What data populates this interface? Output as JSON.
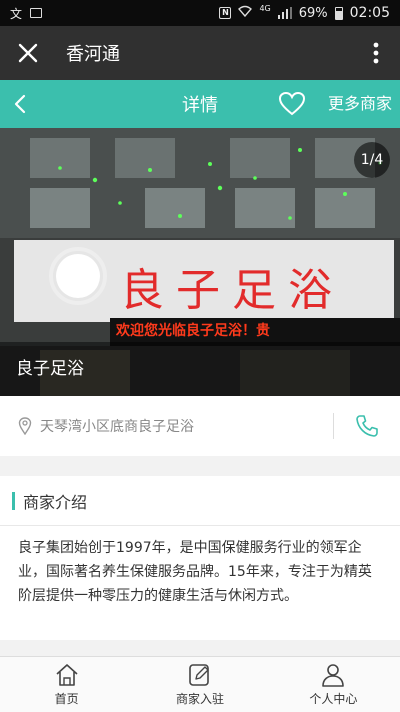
{
  "status_bar": {
    "time": "02:05",
    "battery": "69%",
    "network": "4G"
  },
  "app_bar": {
    "title": "香河通",
    "close_icon": "close-icon",
    "more_icon": "more-vertical-icon"
  },
  "detail_bar": {
    "title": "详情",
    "more_shops": "更多商家",
    "accent": "#3bbfad"
  },
  "photo": {
    "counter": "1/4",
    "caption": "良子足浴",
    "sign_text": "良子足浴",
    "led_text": "欢迎您光临良子足浴！贵"
  },
  "address": {
    "text": "天琴湾小区底商良子足浴"
  },
  "intro": {
    "title": "商家介绍",
    "body": "良子集团始创于1997年，是中国保健服务行业的领军企业，国际著名养生保健服务品牌。15年来，专注于为精英阶层提供一种零压力的健康生活与休闲方式。"
  },
  "tabs": [
    {
      "label": "首页",
      "icon": "home-icon"
    },
    {
      "label": "商家入驻",
      "icon": "edit-icon"
    },
    {
      "label": "个人中心",
      "icon": "person-icon"
    }
  ]
}
